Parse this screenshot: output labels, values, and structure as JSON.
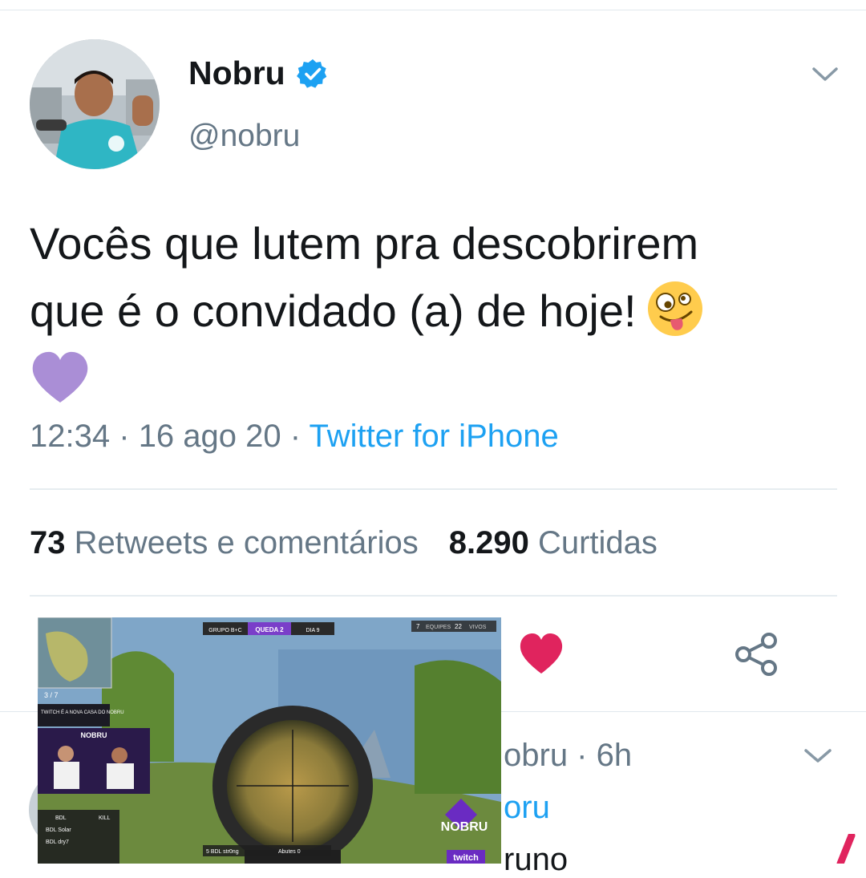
{
  "tweet": {
    "author_name": "Nobru",
    "author_handle": "@nobru",
    "text_line1": "Vocês que lutem pra descobrirem",
    "text_line2": "que é o convidado (a) de hoje!",
    "emoji_names": [
      "zany-face-emoji",
      "purple-heart-emoji"
    ],
    "time": "12:34",
    "date": "16 ago 20",
    "separator": "·",
    "source": "Twitter for iPhone"
  },
  "stats": {
    "retweets_count": "73",
    "retweets_label": "Retweets e comentários",
    "likes_count": "8.290",
    "likes_label": "Curtidas"
  },
  "actions": {
    "like_icon": "heart-icon",
    "share_icon": "share-icon",
    "liked_color": "#e0245e"
  },
  "reply": {
    "meta": "obru · 6h",
    "handle": "oru",
    "text_fragment": "runo"
  },
  "stream_overlay": {
    "group": "GRUPO B+C",
    "match": "QUEDA 2",
    "day": "DIA 9",
    "teams_label": "EQUIPES",
    "teams": "7",
    "alive_label": "VIVOS",
    "alive": "22",
    "compass": "3 / 7",
    "promo": "TWITCH É A NOVA CASA DO NOBRU",
    "brand": "NOBRU",
    "platform": "twitch",
    "team_tag": "BDL",
    "kill_label": "KILL",
    "players": [
      "BDL Solar",
      "BDL dry7",
      "BDL str0ng"
    ],
    "bottom_score": "5 BDL str0ng",
    "bottom_enemy": "Abutes 0"
  },
  "colors": {
    "text": "#14171a",
    "secondary": "#657786",
    "link": "#1da1f2",
    "verified": "#1da1f2",
    "heart_emoji": "#aa8ed6"
  }
}
